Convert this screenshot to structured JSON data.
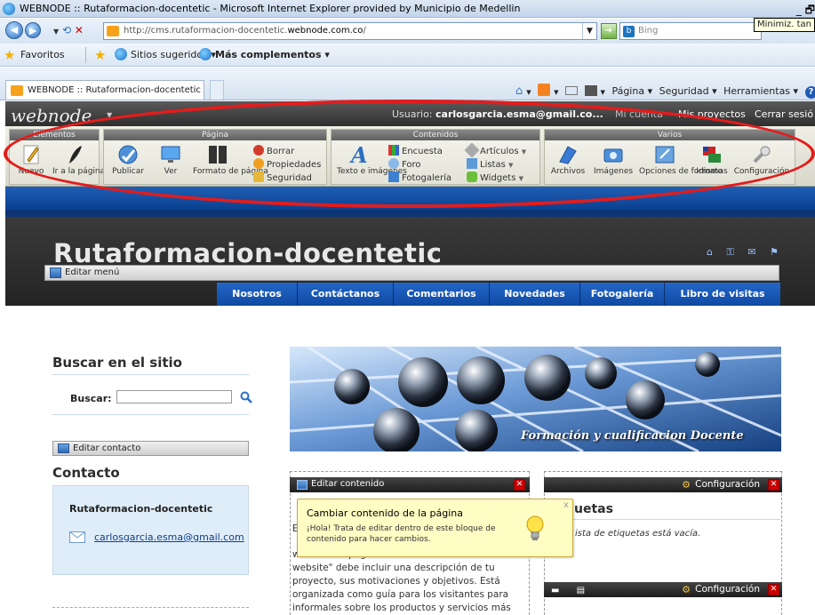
{
  "window": {
    "title": "WEBNODE :: Rutaformacion-docentetic - Microsoft Internet Explorer provided by Municipio de Medellin",
    "controls": "_ 🗗",
    "minimize_tooltip": "Minimiz. tan"
  },
  "address_bar": {
    "url_prefix": "http://cms.rutaformacion-docentetic.",
    "url_domain": "webnode.com.co",
    "url_suffix": "/",
    "search_placeholder": "Bing"
  },
  "favorites_bar": {
    "favorites_label": "Favoritos",
    "suggested_label": "Sitios sugeridos ▾",
    "addons_label": "Más complementos ▾"
  },
  "browser_tab": {
    "title": "WEBNODE :: Rutaformacion-docentetic"
  },
  "command_bar": {
    "page": "Página ▾",
    "safety": "Seguridad ▾",
    "tools": "Herramientas ▾",
    "help": "?"
  },
  "webnode": {
    "logo": "webnode",
    "user_prefix": "Usuario: ",
    "user_email": "carlosgarcia.esma@gmail.co...",
    "my_account": "Mi cuenta",
    "my_projects": "Mis proyectos",
    "logout": "Cerrar sesió"
  },
  "ribbon": {
    "groups": {
      "elementos": "Elementos",
      "pagina": "Página",
      "contenidos": "Contenidos",
      "varios": "Varios"
    },
    "nuevo": "Nuevo",
    "ir_a_pagina": "Ir a la página",
    "publicar": "Publicar",
    "ver": "Ver",
    "formato_pagina": "Formato de página",
    "borrar": "Borrar",
    "propiedades": "Propiedades",
    "seguridad": "Seguridad",
    "texto_imagenes": "Texto e imágenes",
    "encuesta": "Encuesta",
    "foro": "Foro",
    "fotogaleria": "Fotogalería",
    "articulos": "Artículos",
    "listas": "Listas",
    "widgets": "Widgets",
    "archivos": "Archivos",
    "imagenes": "Imágenes",
    "opciones_formato": "Opciones de formato",
    "idiomas": "Idiomas",
    "configuracion": "Configuración"
  },
  "site": {
    "title": "Rutaformacion-docentetic",
    "edit_menu": "Editar menú",
    "nav": [
      "Nosotros",
      "Contáctanos",
      "Comentarios",
      "Novedades",
      "Fotogalería",
      "Libro de visitas"
    ]
  },
  "sidebar": {
    "search_title": "Buscar en el sitio",
    "search_label": "Buscar:",
    "edit_contact": "Editar contacto",
    "contact_title": "Contacto",
    "contact_name": "Rutaformacion-docentetic",
    "contact_email": "carlosgarcia.esma@gmail.com"
  },
  "banner": {
    "caption": "Formación y cualificacion Docente"
  },
  "content": {
    "edit_content": "Editar contenido",
    "partial_line": "E                                                     c",
    "body": "website. La página \"Bienvenidos a nuestro website\" debe incluir una descripción de tu proyecto, sus motivaciones y objetivos. Está organizada como guía para los visitantes para informales sobre los productos y servicios más importantes que ofrecer"
  },
  "popup": {
    "title": "Cambiar contenido de la página",
    "message": "¡Hola! Trata de editar dentro de este bloque de contenido para hacer cambios.",
    "close": "x"
  },
  "right_panel": {
    "config": "Configuración",
    "tags_title": "uetas",
    "tags_empty": "ista de etiquetas está vacía."
  }
}
